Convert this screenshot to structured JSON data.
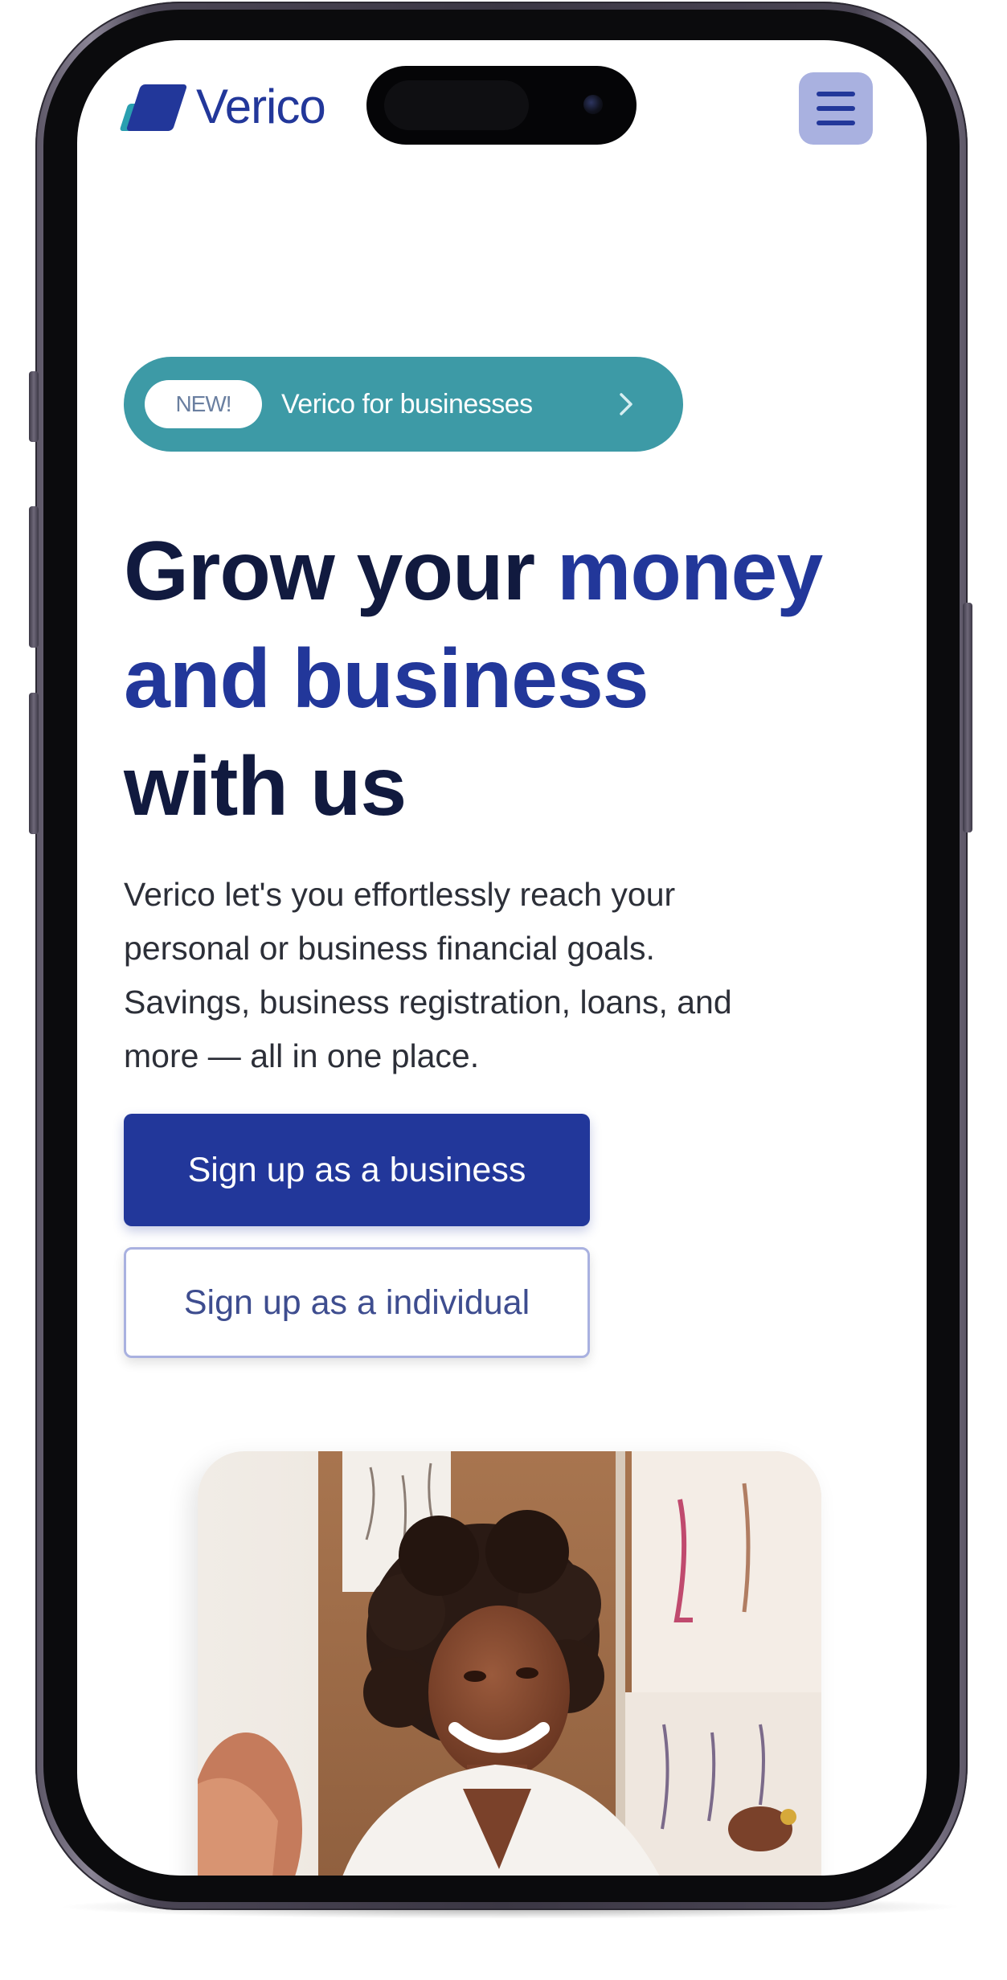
{
  "header": {
    "brand_name": "Verico",
    "menu_icon": "hamburger-menu-icon"
  },
  "badge": {
    "tag": "NEW!",
    "label": "Verico for businesses",
    "chevron_icon": "chevron-right-icon"
  },
  "hero": {
    "headline_part1": "Grow your ",
    "headline_part2": "money",
    "headline_part3": "and business",
    "headline_part4": "with us",
    "description": "Verico let's you effortlessly reach your personal or business financial goals. Savings, business registration, loans, and more — all in one place.",
    "primary_cta": "Sign up as a business",
    "secondary_cta": "Sign up as a individual",
    "image_icon": "woman-smiling-photo"
  },
  "colors": {
    "brand_blue": "#22379a",
    "teal": "#3d9aa6",
    "dark_text": "#111a3f",
    "menu_bg": "#a9b1e0"
  }
}
